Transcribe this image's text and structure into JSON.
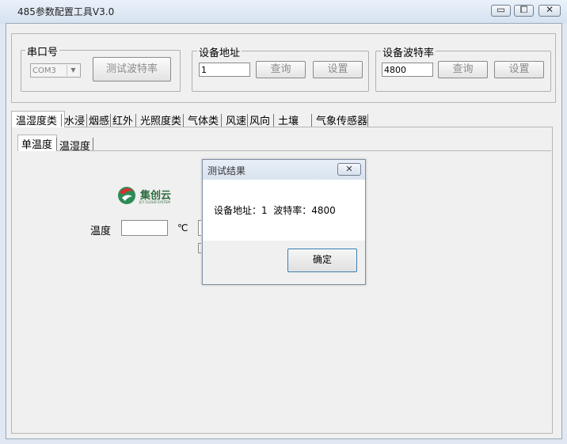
{
  "window": {
    "title": "485参数配置工具V3.0",
    "controls": {
      "minimize": "▭",
      "maximize": "⧠",
      "close": "✕"
    }
  },
  "serial_port": {
    "group_label": "串口号",
    "port_value": "COM3",
    "test_baud_button": "测试波特率"
  },
  "device_address": {
    "group_label": "设备地址",
    "value": "1",
    "query_button": "查询",
    "set_button": "设置"
  },
  "device_baud": {
    "group_label": "设备波特率",
    "value": "4800",
    "query_button": "查询",
    "set_button": "设置"
  },
  "tabs": [
    "温湿度类",
    "水浸",
    "烟感",
    "红外",
    "光照度类",
    "气体类",
    "风速",
    "风向",
    "土壤",
    "气象传感器"
  ],
  "subtabs": [
    "单温度",
    "温湿度"
  ],
  "logo": {
    "name": "集创云",
    "tagline": "JCY CLOUD SYSTEM"
  },
  "temperature": {
    "label": "温度",
    "value": "",
    "unit": "℃"
  },
  "dialog": {
    "title": "测试结果",
    "message": "设备地址：1  波特率：4800",
    "ok_button": "确定",
    "close_icon": "✕"
  },
  "colors": {
    "accent": "#3c7fb1",
    "logo_green": "#2e8b57",
    "logo_red": "#d9302c"
  }
}
